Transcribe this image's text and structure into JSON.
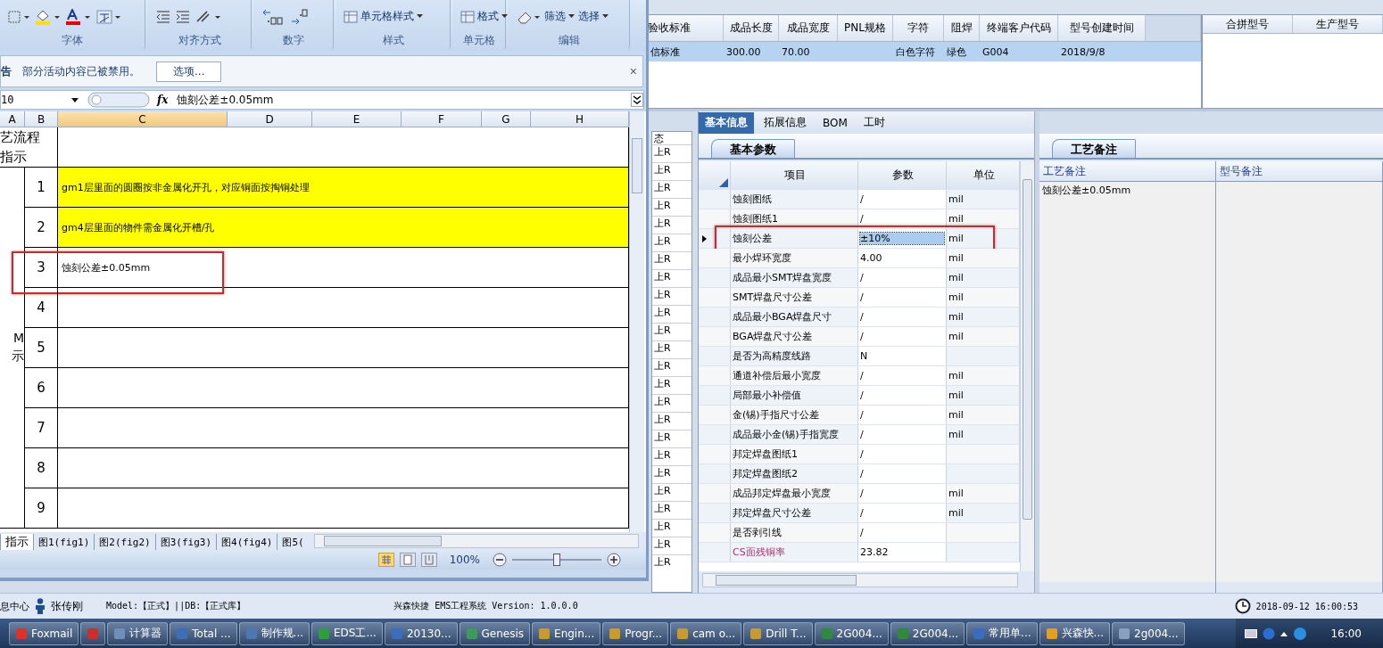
{
  "excel": {
    "ribbon_groups": [
      {
        "label": "字体",
        "kind": "font"
      },
      {
        "label": "对齐方式",
        "kind": "align"
      },
      {
        "label": "数字",
        "kind": "number"
      },
      {
        "label": "样式",
        "kind": "text",
        "buttons": [
          "单元格样式"
        ]
      },
      {
        "label": "单元格",
        "kind": "text",
        "buttons": [
          "格式"
        ]
      },
      {
        "label": "编辑",
        "kind": "edit",
        "buttons": [
          "筛选",
          "选择"
        ]
      }
    ],
    "message_bar": {
      "title": "告",
      "text": "部分活动内容已被禁用。",
      "button": "选项...",
      "close": "×"
    },
    "formula_bar": {
      "name_box": "10",
      "function_label": "fx",
      "formula": "蚀刻公差±0.05mm"
    },
    "columns": [
      "A",
      "B",
      "C",
      "D",
      "E",
      "F",
      "G",
      "H"
    ],
    "title_cell": [
      "艺流程",
      "指示"
    ],
    "side_labels": [
      "M",
      "示"
    ],
    "rows": [
      {
        "number": "1",
        "text": "gm1层里面的圆圈按非金属化开孔，对应铜面按掏铜处理",
        "highlight": true,
        "marked": false
      },
      {
        "number": "2",
        "text": "gm4层里面的物件需金属化开槽/孔",
        "highlight": true,
        "marked": false
      },
      {
        "number": "3",
        "text": "蚀刻公差±0.05mm",
        "highlight": false,
        "marked": true
      },
      {
        "number": "4",
        "highlight": false,
        "marked": false
      },
      {
        "number": "5",
        "highlight": false,
        "marked": false
      },
      {
        "number": "6",
        "highlight": false,
        "marked": false
      },
      {
        "number": "7",
        "highlight": false,
        "marked": false
      },
      {
        "number": "8",
        "highlight": false,
        "marked": false
      },
      {
        "number": "9",
        "highlight": false,
        "marked": false
      }
    ],
    "sheet_tabs": [
      {
        "label": "指示",
        "selected": true
      },
      {
        "label": "图1(fig1)",
        "selected": false
      },
      {
        "label": "图2(fig2)",
        "selected": false
      },
      {
        "label": "图3(fig3)",
        "selected": false
      },
      {
        "label": "图4(fig4)",
        "selected": false
      },
      {
        "label": "图5(",
        "selected": false
      }
    ],
    "zoom": "100%",
    "zoom_slider": {
      "level": 0.5
    }
  },
  "main": {
    "table": {
      "columns": [
        "验收标准",
        "成品长度",
        "成品宽度",
        "PNL规格",
        "字符",
        "阻焊",
        "终端客户代码",
        "型号创建时间"
      ],
      "rows": [
        {
          "cells": [
            "信标准",
            "300.00",
            "70.00",
            null,
            "白色字符",
            "绿色",
            "G004",
            "2018/9/8"
          ],
          "selected": true
        }
      ]
    },
    "merge_table": {
      "columns": [
        "合拼型号",
        "生产型号"
      ]
    },
    "status_list": {
      "header": "态",
      "rows": [
        "上R",
        "上R",
        "上R",
        "上R",
        "上R",
        "上R",
        "上R",
        "上R",
        "上R",
        "上R",
        "上R",
        "上R",
        "上R",
        "上R",
        "上R",
        "上R",
        "上R",
        "上R",
        "上R",
        "上R",
        "上R",
        "上R",
        "上R",
        "上R"
      ]
    },
    "tabs": [
      {
        "label": "基本信息",
        "selected": true
      },
      {
        "label": "拓展信息",
        "selected": false
      },
      {
        "label": "BOM",
        "selected": false
      },
      {
        "label": "工时",
        "selected": false
      }
    ],
    "params": {
      "tab": "基本参数",
      "columns": [
        "项目",
        "参数",
        "单位"
      ],
      "rows": [
        {
          "item": "蚀刻图纸",
          "value": "/",
          "unit": "mil",
          "selected": false,
          "marked": false,
          "kind": "plain"
        },
        {
          "item": "蚀刻图纸1",
          "value": "/",
          "unit": "mil",
          "selected": false,
          "marked": false,
          "kind": "plain"
        },
        {
          "item": "蚀刻公差",
          "value": "±10%",
          "unit": "mil",
          "selected": true,
          "marked": true,
          "kind": "plain"
        },
        {
          "item": "最小焊环宽度",
          "value": "4.00",
          "unit": "mil",
          "selected": false,
          "marked": false,
          "kind": "plain"
        },
        {
          "item": "成品最小SMT焊盘宽度",
          "value": "/",
          "unit": "mil",
          "selected": false,
          "marked": false,
          "kind": "plain"
        },
        {
          "item": "SMT焊盘尺寸公差",
          "value": "/",
          "unit": "mil",
          "selected": false,
          "marked": false,
          "kind": "plain"
        },
        {
          "item": "成品最小BGA焊盘尺寸",
          "value": "/",
          "unit": "mil",
          "selected": false,
          "marked": false,
          "kind": "plain"
        },
        {
          "item": "BGA焊盘尺寸公差",
          "value": "/",
          "unit": "mil",
          "selected": false,
          "marked": false,
          "kind": "plain"
        },
        {
          "item": "是否为高精度线路",
          "value": "N",
          "selected": false,
          "marked": false,
          "kind": "plain"
        },
        {
          "item": "通道补偿后最小宽度",
          "value": "/",
          "unit": "mil",
          "selected": false,
          "marked": false,
          "kind": "plain"
        },
        {
          "item": "局部最小补偿值",
          "value": "/",
          "unit": "mil",
          "selected": false,
          "marked": false,
          "kind": "plain"
        },
        {
          "item": "金(锡)手指尺寸公差",
          "value": "/",
          "unit": "mil",
          "selected": false,
          "marked": false,
          "kind": "plain"
        },
        {
          "item": "成品最小金(锡)手指宽度",
          "value": "/",
          "unit": "mil",
          "selected": false,
          "marked": false,
          "kind": "plain"
        },
        {
          "item": "邦定焊盘图纸1",
          "value": "/",
          "selected": false,
          "marked": false,
          "kind": "plain"
        },
        {
          "item": "邦定焊盘图纸2",
          "value": "/",
          "selected": false,
          "marked": false,
          "kind": "plain"
        },
        {
          "item": "成品邦定焊盘最小宽度",
          "value": "/",
          "unit": "mil",
          "selected": false,
          "marked": false,
          "kind": "plain"
        },
        {
          "item": "邦定焊盘尺寸公差",
          "value": "/",
          "unit": "mil",
          "selected": false,
          "marked": false,
          "kind": "plain"
        },
        {
          "item": "是否剥引线",
          "value": "/",
          "selected": false,
          "marked": false,
          "kind": "plain"
        },
        {
          "item": "CS面残铜率",
          "value": "23.82",
          "selected": false,
          "marked": false,
          "kind": "ratio"
        }
      ]
    },
    "notes": {
      "tab": "工艺备注",
      "columns": [
        {
          "header": "工艺备注",
          "text": "蚀刻公差±0.05mm"
        },
        {
          "header": "型号备注"
        }
      ]
    },
    "status_bar": {
      "left": "息中心",
      "user": "张传刚",
      "model": "Model:【正式】||DB:【正式库】",
      "title": "兴森快捷 EMS工程系统 Version: 1.0.0.0",
      "datetime": "2018-09-12 16:00:53"
    },
    "taskbar": {
      "items": [
        {
          "label": "Foxmail",
          "color": "#d8342c"
        },
        {
          "color": "#c8302a"
        },
        {
          "label": "计算器",
          "color": "#6f8fb8"
        },
        {
          "label": "Total ...",
          "color": "#3d6fb8"
        },
        {
          "label": "制作规...",
          "color": "#4a78b0"
        },
        {
          "label": "EDS工...",
          "color": "#2e9e3a"
        },
        {
          "label": "20130...",
          "color": "#3a6cc0"
        },
        {
          "label": "Genesis",
          "color": "#3c9a5a"
        },
        {
          "label": "Engin...",
          "color": "#c89a30"
        },
        {
          "label": "Progr...",
          "color": "#c89a30"
        },
        {
          "label": "cam o...",
          "color": "#c89a30"
        },
        {
          "label": "Drill T...",
          "color": "#c89a30"
        },
        {
          "label": "2G004...",
          "color": "#2f8a3c"
        },
        {
          "label": "2G004...",
          "color": "#2f8a3c"
        },
        {
          "label": "常用单...",
          "color": "#3a6cc0"
        },
        {
          "label": "兴森快...",
          "color": "#e0a020"
        },
        {
          "label": "2g004...",
          "color": "#8aa0c0"
        }
      ],
      "clock": "16:00"
    }
  }
}
